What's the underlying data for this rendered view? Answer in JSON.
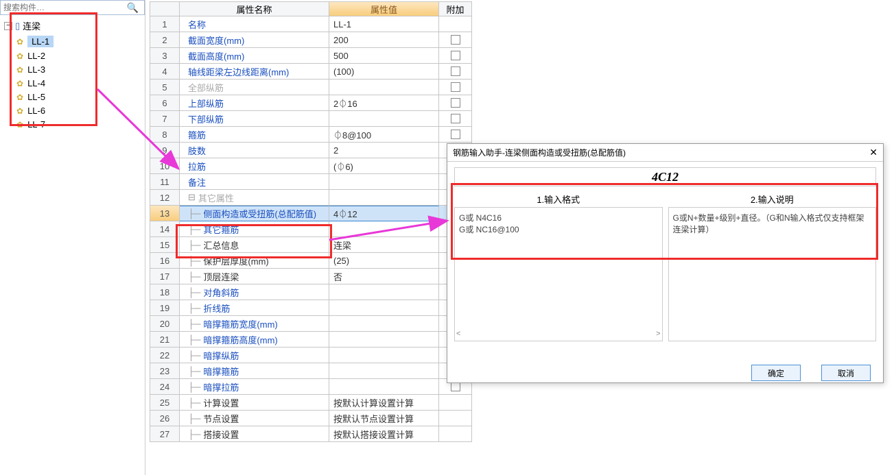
{
  "search": {
    "placeholder": "搜索构件…"
  },
  "tree": {
    "root": "连梁",
    "items": [
      "LL-1",
      "LL-2",
      "LL-3",
      "LL-4",
      "LL-5",
      "LL-6",
      "LL-7"
    ]
  },
  "table": {
    "headers": {
      "name": "属性名称",
      "value": "属性值",
      "extra": "附加"
    },
    "rows": [
      {
        "n": 1,
        "name": "名称",
        "value": "LL-1",
        "ck": false,
        "link": true
      },
      {
        "n": 2,
        "name": "截面宽度(mm)",
        "value": "200",
        "ck": true,
        "link": true
      },
      {
        "n": 3,
        "name": "截面高度(mm)",
        "value": "500",
        "ck": true,
        "link": true
      },
      {
        "n": 4,
        "name": "轴线距梁左边线距离(mm)",
        "value": "(100)",
        "ck": true,
        "link": true
      },
      {
        "n": 5,
        "name": "全部纵筋",
        "value": "",
        "ck": true,
        "gray": true
      },
      {
        "n": 6,
        "name": "上部纵筋",
        "value": "2⏀16",
        "ck": true,
        "link": true
      },
      {
        "n": 7,
        "name": "下部纵筋",
        "value": "",
        "ck": true,
        "link": true
      },
      {
        "n": 8,
        "name": "箍筋",
        "value": "⏀8@100",
        "ck": true,
        "link": true
      },
      {
        "n": 9,
        "name": "肢数",
        "value": "2",
        "ck": false,
        "link": true
      },
      {
        "n": 10,
        "name": "拉筋",
        "value": "(⏀6)",
        "ck": true,
        "link": true
      },
      {
        "n": 11,
        "name": "备注",
        "value": "",
        "ck": true,
        "link": true
      },
      {
        "n": 12,
        "name": "其它属性",
        "value": "",
        "ck": false,
        "gray": true,
        "collapse": true
      },
      {
        "n": 13,
        "name": "侧面构造或受扭筋(总配筋值)",
        "value": "4⏀12",
        "ck": true,
        "link": true,
        "ind": true,
        "sel": true
      },
      {
        "n": 14,
        "name": "其它箍筋",
        "value": "",
        "ck": true,
        "link": true,
        "ind": true
      },
      {
        "n": 15,
        "name": "汇总信息",
        "value": "连梁",
        "ck": true,
        "ind": true
      },
      {
        "n": 16,
        "name": "保护层厚度(mm)",
        "value": "(25)",
        "ck": true,
        "ind": true
      },
      {
        "n": 17,
        "name": "顶层连梁",
        "value": "否",
        "ck": true,
        "ind": true
      },
      {
        "n": 18,
        "name": "对角斜筋",
        "value": "",
        "ck": true,
        "link": true,
        "ind": true
      },
      {
        "n": 19,
        "name": "折线筋",
        "value": "",
        "ck": true,
        "link": true,
        "ind": true
      },
      {
        "n": 20,
        "name": "暗撑箍筋宽度(mm)",
        "value": "",
        "ck": true,
        "link": true,
        "ind": true
      },
      {
        "n": 21,
        "name": "暗撑箍筋高度(mm)",
        "value": "",
        "ck": true,
        "link": true,
        "ind": true
      },
      {
        "n": 22,
        "name": "暗撑纵筋",
        "value": "",
        "ck": true,
        "link": true,
        "ind": true
      },
      {
        "n": 23,
        "name": "暗撑箍筋",
        "value": "",
        "ck": true,
        "link": true,
        "ind": true
      },
      {
        "n": 24,
        "name": "暗撑拉筋",
        "value": "",
        "ck": true,
        "link": true,
        "ind": true
      },
      {
        "n": 25,
        "name": "计算设置",
        "value": "按默认计算设置计算",
        "ck": false,
        "ind": true
      },
      {
        "n": 26,
        "name": "节点设置",
        "value": "按默认节点设置计算",
        "ck": false,
        "ind": true
      },
      {
        "n": 27,
        "name": "搭接设置",
        "value": "按默认搭接设置计算",
        "ck": false,
        "ind": true
      }
    ]
  },
  "dialog": {
    "title": "钢筋输入助手-连梁侧面构造或受扭筋(总配筋值)",
    "preview": "4C12",
    "col1_header": "1.输入格式",
    "col1_line1": "G或 N4C16",
    "col1_line2": "G或 NC16@100",
    "col2_header": "2.输入说明",
    "col2_body": "G或N+数量+级别+直径。（G和N输入格式仅支持框架连梁计算）",
    "ok": "确定",
    "cancel": "取消"
  }
}
